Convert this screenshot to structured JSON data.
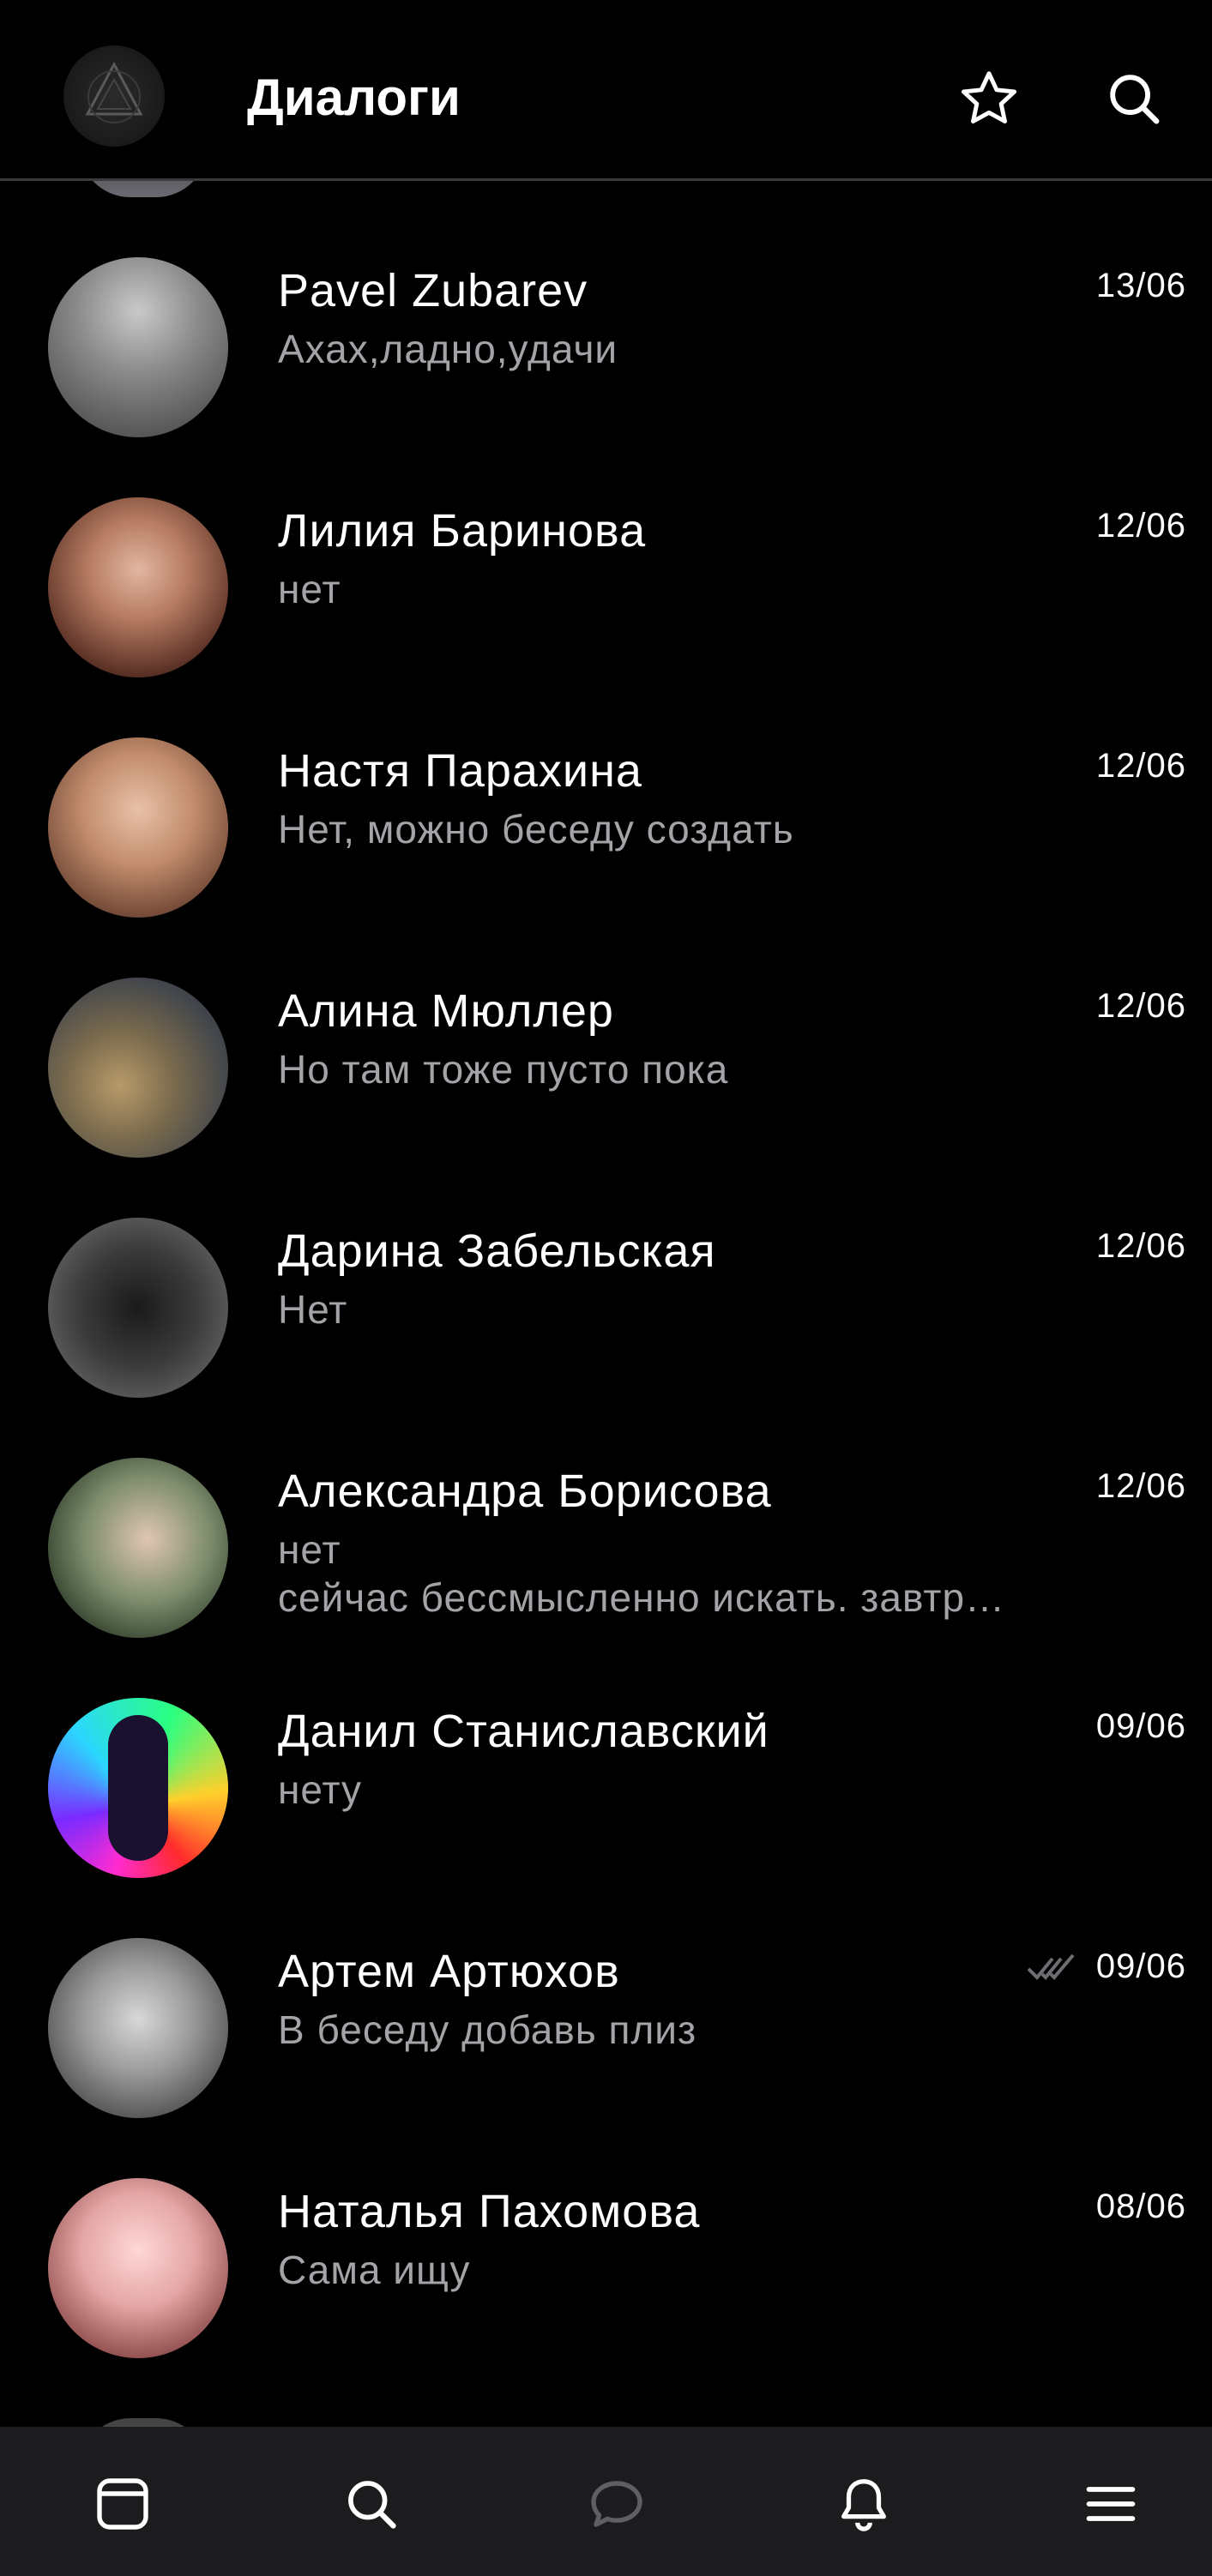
{
  "header": {
    "title": "Диалоги",
    "icons": [
      "avatar",
      "star-icon",
      "search-icon"
    ]
  },
  "dialogs": [
    {
      "name": "Pavel Zubarev",
      "message": "Ахах,ладно,удачи",
      "date": "13/06"
    },
    {
      "name": "Лилия Баринова",
      "message": "нет",
      "date": "12/06"
    },
    {
      "name": "Настя Парахина",
      "message": "Нет, можно беседу создать",
      "date": "12/06"
    },
    {
      "name": "Алина Мюллер",
      "message": "Но там тоже пусто пока",
      "date": "12/06"
    },
    {
      "name": "Дарина Забельская",
      "message": "Нет",
      "date": "12/06"
    },
    {
      "name": "Александра Борисова",
      "message": "нет",
      "message_line2": "сейчас бессмысленно искать. завтр…",
      "date": "12/06"
    },
    {
      "name": "Данил Станиславский",
      "message": "нету",
      "date": "09/06"
    },
    {
      "name": "Артем Артюхов",
      "message": "В беседу добавь плиз",
      "date": "09/06",
      "read_icon": "double-check-icon"
    },
    {
      "name": "Наталья Пахомова",
      "message": "Сама ищу",
      "date": "08/06"
    }
  ],
  "bottom_nav": {
    "items": [
      "newsfeed-icon",
      "search-icon",
      "messages-icon",
      "notifications-icon",
      "menu-icon"
    ],
    "active": "messages-icon"
  },
  "colors": {
    "background": "#000000",
    "text_primary": "#ffffff",
    "text_secondary": "#a3a3a8",
    "nav_background": "#1c1c1e",
    "divider": "#3a3a3c"
  }
}
